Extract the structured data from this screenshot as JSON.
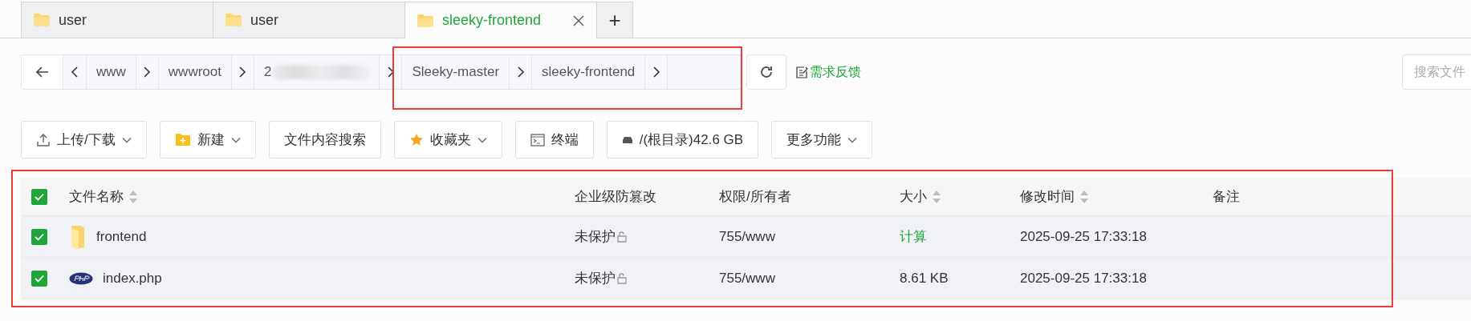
{
  "tabs": [
    {
      "label": "user",
      "selected": false
    },
    {
      "label": "user",
      "selected": false
    },
    {
      "label": "sleeky-frontend",
      "selected": true
    }
  ],
  "new_tab": "+",
  "breadcrumb": [
    {
      "label": "www",
      "redacted": false
    },
    {
      "label": "wwwroot",
      "redacted": false
    },
    {
      "label": "2",
      "redacted": true
    },
    {
      "label": "Sleeky-master",
      "redacted": false
    },
    {
      "label": "sleeky-frontend",
      "redacted": false
    }
  ],
  "feedback_link": "需求反馈",
  "search": {
    "placeholder": "搜索文件"
  },
  "toolbar": [
    {
      "kind": "transfer",
      "label": "上传/下载",
      "dropdown": true
    },
    {
      "kind": "create",
      "label": "新建",
      "dropdown": true
    },
    {
      "kind": "plain",
      "label": "文件内容搜索",
      "dropdown": false
    },
    {
      "kind": "favorites",
      "label": "收藏夹",
      "dropdown": true
    },
    {
      "kind": "terminal",
      "label": "终端",
      "dropdown": false
    },
    {
      "kind": "disk",
      "label": "/(根目录)42.6 GB",
      "dropdown": false
    },
    {
      "kind": "plain",
      "label": "更多功能",
      "dropdown": true
    }
  ],
  "table": {
    "all_checked": true,
    "columns": [
      {
        "label": "文件名称",
        "sortable": true
      },
      {
        "label": "企业级防篡改",
        "sortable": false
      },
      {
        "label": "权限/所有者",
        "sortable": false
      },
      {
        "label": "大小",
        "sortable": true
      },
      {
        "label": "修改时间",
        "sortable": true
      },
      {
        "label": "备注",
        "sortable": false
      }
    ],
    "rows": [
      {
        "kind": "folder",
        "checked": true,
        "name": "frontend",
        "protection": "未保护",
        "permission": "755/www",
        "size": "计算",
        "size_is_link": true,
        "modified": "2025-09-25 17:33:18"
      },
      {
        "kind": "php",
        "checked": true,
        "name": "index.php",
        "protection": "未保护",
        "permission": "755/www",
        "size": "8.61 KB",
        "size_is_link": false,
        "modified": "2025-09-25 17:33:18"
      }
    ]
  },
  "highlights": {
    "breadcrumb": true,
    "file_list": true
  }
}
